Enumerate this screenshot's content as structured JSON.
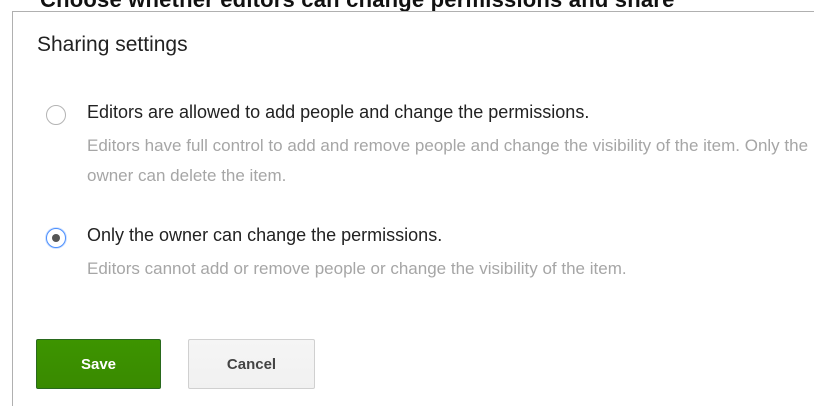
{
  "header_strip": {
    "text": "Choose whether editors can change permissions and share"
  },
  "dialog": {
    "title": "Sharing settings",
    "options": [
      {
        "label": "Editors are allowed to add people and change the permissions.",
        "description": "Editors have full control to add and remove people and change the visibility of the item. Only the owner can delete the item.",
        "selected": false
      },
      {
        "label": "Only the owner can change the permissions.",
        "description": "Editors cannot add or remove people or change the visibility of the item.",
        "selected": true
      }
    ],
    "buttons": {
      "save_label": "Save",
      "cancel_label": "Cancel"
    }
  },
  "colors": {
    "save_button": "#3d9400",
    "selected_radio_ring": "#4d90fe",
    "description_text": "#a6a6a6"
  }
}
